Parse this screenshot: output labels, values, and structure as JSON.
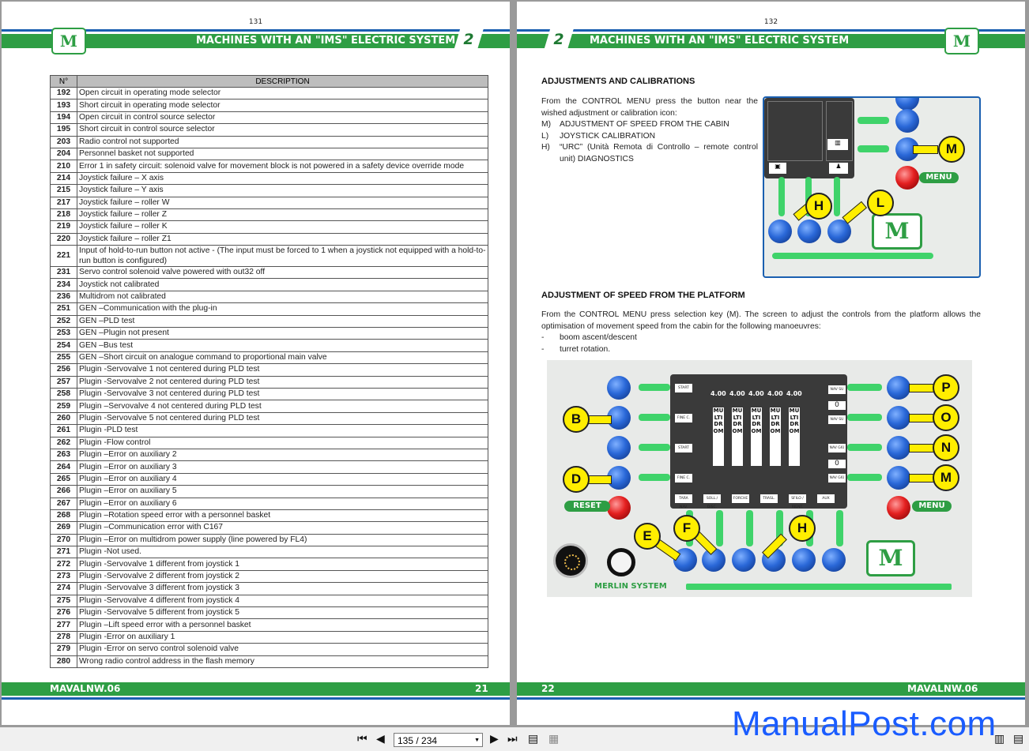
{
  "left_page": {
    "page_number": "131",
    "header_title": "MACHINES WITH AN \"IMS\" ELECTRIC SYSTEM",
    "chapter": "2",
    "footer_code": "MAVALNW.06",
    "footer_page": "21",
    "table": {
      "col_num": "N°",
      "col_desc": "DESCRIPTION",
      "rows": [
        {
          "n": "192",
          "d": "Open circuit in operating mode selector"
        },
        {
          "n": "193",
          "d": "Short circuit in operating mode selector"
        },
        {
          "n": "194",
          "d": "Open circuit in control source selector"
        },
        {
          "n": "195",
          "d": "Short circuit in control source selector"
        },
        {
          "n": "203",
          "d": "Radio control not supported"
        },
        {
          "n": "204",
          "d": "Personnel basket not supported"
        },
        {
          "n": "210",
          "d": "Error 1 in safety circuit: solenoid valve for movement block is not powered in a safety device override mode"
        },
        {
          "n": "214",
          "d": "Joystick failure – X axis"
        },
        {
          "n": "215",
          "d": "Joystick failure – Y axis"
        },
        {
          "n": "217",
          "d": "Joystick failure – roller W"
        },
        {
          "n": "218",
          "d": "Joystick failure – roller Z"
        },
        {
          "n": "219",
          "d": "Joystick failure – roller K"
        },
        {
          "n": "220",
          "d": "Joystick failure – roller Z1"
        },
        {
          "n": "221",
          "d": "Input of hold-to-run button not active - (The input must be forced to 1 when a joystick not equipped with a hold-to-run button is configured)"
        },
        {
          "n": "231",
          "d": "Servo control solenoid valve powered with out32 off"
        },
        {
          "n": "234",
          "d": "Joystick not calibrated"
        },
        {
          "n": "236",
          "d": "Multidrom not calibrated"
        },
        {
          "n": "251",
          "d": "GEN –Communication with the plug-in"
        },
        {
          "n": "252",
          "d": "GEN –PLD test"
        },
        {
          "n": "253",
          "d": "GEN –Plugin not present"
        },
        {
          "n": "254",
          "d": "GEN –Bus test"
        },
        {
          "n": "255",
          "d": "GEN –Short circuit on analogue command to proportional main valve"
        },
        {
          "n": "256",
          "d": "Plugin -Servovalve 1 not centered during PLD test"
        },
        {
          "n": "257",
          "d": "Plugin -Servovalve 2 not centered during PLD test"
        },
        {
          "n": "258",
          "d": "Plugin -Servovalve 3 not centered during PLD test"
        },
        {
          "n": "259",
          "d": "Plugin –Servovalve 4 not centered during PLD test"
        },
        {
          "n": "260",
          "d": "Plugin -Servovalve 5 not centered during PLD test"
        },
        {
          "n": "261",
          "d": "Plugin -PLD test"
        },
        {
          "n": "262",
          "d": "Plugin -Flow control"
        },
        {
          "n": "263",
          "d": "Plugin –Error on auxiliary 2"
        },
        {
          "n": "264",
          "d": "Plugin –Error on auxiliary 3"
        },
        {
          "n": "265",
          "d": "Plugin –Error on auxiliary 4"
        },
        {
          "n": "266",
          "d": "Plugin –Error on auxiliary 5"
        },
        {
          "n": "267",
          "d": "Plugin –Error on auxiliary 6"
        },
        {
          "n": "268",
          "d": "Plugin –Rotation speed error with a personnel basket"
        },
        {
          "n": "269",
          "d": "Plugin –Communication error with C167"
        },
        {
          "n": "270",
          "d": "Plugin –Error on multidrom power supply (line powered by FL4)"
        },
        {
          "n": "271",
          "d": "Plugin -Not used."
        },
        {
          "n": "272",
          "d": "Plugin -Servovalve 1 different from joystick 1"
        },
        {
          "n": "273",
          "d": "Plugin -Servovalve 2 different from joystick 2"
        },
        {
          "n": "274",
          "d": "Plugin -Servovalve 3 different from joystick 3"
        },
        {
          "n": "275",
          "d": "Plugin -Servovalve 4 different from joystick 4"
        },
        {
          "n": "276",
          "d": "Plugin -Servovalve 5 different from joystick 5"
        },
        {
          "n": "277",
          "d": "Plugin –Lift speed error with a personnel basket"
        },
        {
          "n": "278",
          "d": "Plugin -Error on auxiliary 1"
        },
        {
          "n": "279",
          "d": "Plugin -Error on servo control solenoid valve"
        },
        {
          "n": "280",
          "d": "Wrong radio control address in the flash memory"
        }
      ]
    }
  },
  "right_page": {
    "page_number": "132",
    "header_title": "MACHINES WITH AN \"IMS\" ELECTRIC SYSTEM",
    "chapter": "2",
    "footer_code": "MAVALNW.06",
    "footer_page": "22",
    "section1_title": "ADJUSTMENTS AND CALIBRATIONS",
    "section1_intro": "From the CONTROL MENU press the button near the wished adjustment or calibration icon:",
    "section1_items": [
      {
        "key": "M)",
        "text": "ADJUSTMENT OF SPEED FROM THE CABIN"
      },
      {
        "key": "L)",
        "text": "JOYSTICK CALIBRATION"
      },
      {
        "key": "H)",
        "text": "“URC” (Unità Remota di Controllo – remote control unit) DIAGNOSTICS"
      }
    ],
    "panel1": {
      "menu_label": "MENU",
      "callouts": [
        "M",
        "H",
        "L"
      ]
    },
    "section2_title": "ADJUSTMENT OF SPEED FROM THE PLATFORM",
    "section2_intro": "From the CONTROL MENU press selection key (M). The screen to adjust the controls from the platform allows the optimisation of movement speed from the cabin for the following manoeuvres:",
    "section2_items": [
      {
        "key": "-",
        "text": "boom ascent/descent"
      },
      {
        "key": "-",
        "text": "turret rotation."
      }
    ],
    "panel2": {
      "reset_label": "RESET",
      "menu_label": "MENU",
      "system_label": "MERLIN SYSTEM",
      "display_value": "4.00",
      "column_text": "MULTIDROM",
      "callouts_left": [
        "B",
        "D"
      ],
      "callouts_right": [
        "P",
        "O",
        "N",
        "M"
      ],
      "callouts_bottom": [
        "E",
        "F",
        "H"
      ],
      "left_keys": [
        "START",
        "FINE C.",
        "START",
        "FINE C."
      ],
      "bottom_keys": [
        "TARA NAV.",
        "SOLL./ DISC.",
        "FORCHE",
        "TRASL.",
        "SFILO / RIENT.",
        "AUX"
      ],
      "right_keys": [
        "NAV SU",
        "NAV SU",
        "NAV GIÙ",
        "NAV GIÙ"
      ],
      "right_values": [
        "0",
        "0"
      ]
    }
  },
  "viewer": {
    "page_indicator": "135 / 234",
    "watermark": "ManualPost.com",
    "icons": [
      "first-page-icon",
      "prev-page-icon",
      "next-page-icon",
      "last-page-icon",
      "single-page-view-icon",
      "facing-pages-view-icon",
      "scroll-mode-icon",
      "fit-page-icon"
    ]
  },
  "colors": {
    "brand_green": "#2e9e44",
    "brand_blue": "#1a5fb0",
    "callout_yellow": "#ffee00",
    "watermark_blue": "#1a5cff"
  }
}
